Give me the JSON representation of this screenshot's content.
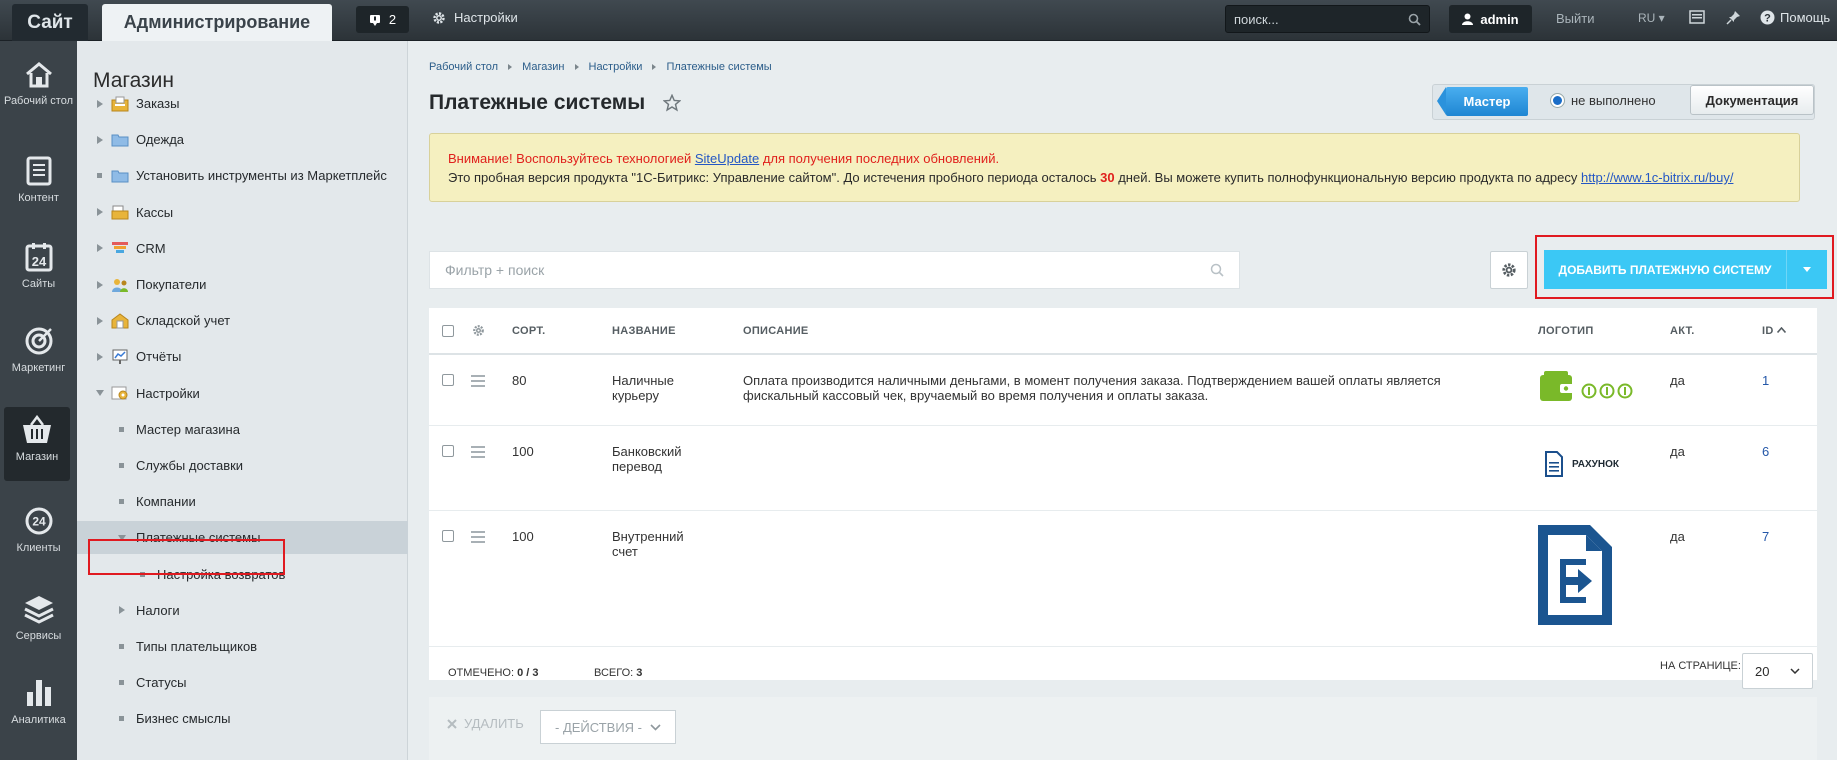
{
  "topbar": {
    "site": "Сайт",
    "admin": "Администрирование",
    "notif_count": "2",
    "settings": "Настройки",
    "search_placeholder": "поиск...",
    "user": "admin",
    "logout": "Выйти",
    "lang": "RU",
    "help": "Помощь"
  },
  "iconbar": [
    {
      "label": "Рабочий стол",
      "icon": "home-icon"
    },
    {
      "label": "Контент",
      "icon": "document-icon"
    },
    {
      "label": "Сайты",
      "icon": "calendar-24-icon"
    },
    {
      "label": "Маркетинг",
      "icon": "target-icon"
    },
    {
      "label": "Магазин",
      "icon": "basket-icon",
      "active": true
    },
    {
      "label": "Клиенты",
      "icon": "clients-24-icon"
    },
    {
      "label": "Сервисы",
      "icon": "layers-icon"
    },
    {
      "label": "Аналитика",
      "icon": "bar-chart-icon"
    }
  ],
  "menu": {
    "title": "Магазин",
    "items": [
      {
        "label": "Заказы",
        "type": "arrow",
        "icon": "orders"
      },
      {
        "label": "Одежда",
        "type": "arrow",
        "icon": "folder"
      },
      {
        "label": "Установить инструменты из Маркетплейс",
        "type": "dot",
        "icon": "folder"
      },
      {
        "label": "Кассы",
        "type": "arrow",
        "icon": "cashbox"
      },
      {
        "label": "CRM",
        "type": "arrow",
        "icon": "crm"
      },
      {
        "label": "Покупатели",
        "type": "arrow",
        "icon": "users"
      },
      {
        "label": "Складской учет",
        "type": "arrow",
        "icon": "store"
      },
      {
        "label": "Отчёты",
        "type": "arrow",
        "icon": "reports"
      },
      {
        "label": "Настройки",
        "type": "down",
        "icon": "settings"
      },
      {
        "label": "Мастер магазина",
        "type": "dot2"
      },
      {
        "label": "Службы доставки",
        "type": "dot2"
      },
      {
        "label": "Компании",
        "type": "dot2"
      },
      {
        "label": "Платежные системы",
        "type": "down2",
        "selected": true
      },
      {
        "label": "Настройка возвратов",
        "type": "dot3"
      },
      {
        "label": "Налоги",
        "type": "arrow2"
      },
      {
        "label": "Типы плательщиков",
        "type": "dot2"
      },
      {
        "label": "Статусы",
        "type": "dot2"
      },
      {
        "label": "Бизнес смыслы",
        "type": "dot2"
      }
    ]
  },
  "breadcrumb": [
    "Рабочий стол",
    "Магазин",
    "Настройки",
    "Платежные системы"
  ],
  "page": {
    "title": "Платежные системы",
    "master": "Мастер",
    "status": "не выполнено",
    "docs": "Документация"
  },
  "notice": {
    "warn_pre": "Внимание! Воспользуйтесь технологией ",
    "warn_link": "SiteUpdate",
    "warn_post": " для получения последних обновлений.",
    "line2_pre": "Это пробная версия продукта \"1С-Битрикс: Управление сайтом\". До истечения пробного периода осталось ",
    "days": "30",
    "line2_post": " дней. Вы можете купить полнофункциональную версию продукта по адресу ",
    "url": "http://www.1c-bitrix.ru/buy/"
  },
  "filter": {
    "placeholder": "Фильтр + поиск"
  },
  "add_button": "ДОБАВИТЬ ПЛАТЕЖНУЮ СИСТЕМУ",
  "table": {
    "columns": [
      "СОРТ.",
      "НАЗВАНИЕ",
      "ОПИСАНИЕ",
      "ЛОГОТИП",
      "АКТ.",
      "ID"
    ],
    "rows": [
      {
        "sort": "80",
        "name": "Наличные курьеру",
        "desc": "Оплата производится наличными деньгами, в момент получения заказа. Подтверждением вашей оплаты является фискальный кассовый чек, вручаемый во время получения и оплаты заказа.",
        "logo": "wallet-coins",
        "active": "да",
        "id": "1"
      },
      {
        "sort": "100",
        "name": "Банковский перевод",
        "desc": "",
        "logo": "РАХУНОК",
        "active": "да",
        "id": "6"
      },
      {
        "sort": "100",
        "name": "Внутренний счет",
        "desc": "",
        "logo": "document-arrow",
        "active": "да",
        "id": "7"
      }
    ]
  },
  "footer": {
    "marked_label": "ОТМЕЧЕНО:",
    "marked": "0 / 3",
    "total_label": "ВСЕГО:",
    "total": "3",
    "per_page_label": "НА СТРАНИЦЕ:",
    "per_page": "20",
    "delete": "УДАЛИТЬ",
    "actions": "- ДЕЙСТВИЯ -"
  },
  "colors": {
    "accent": "#3bc8f5",
    "highlight": "#e01a20",
    "link": "#2457a8"
  }
}
